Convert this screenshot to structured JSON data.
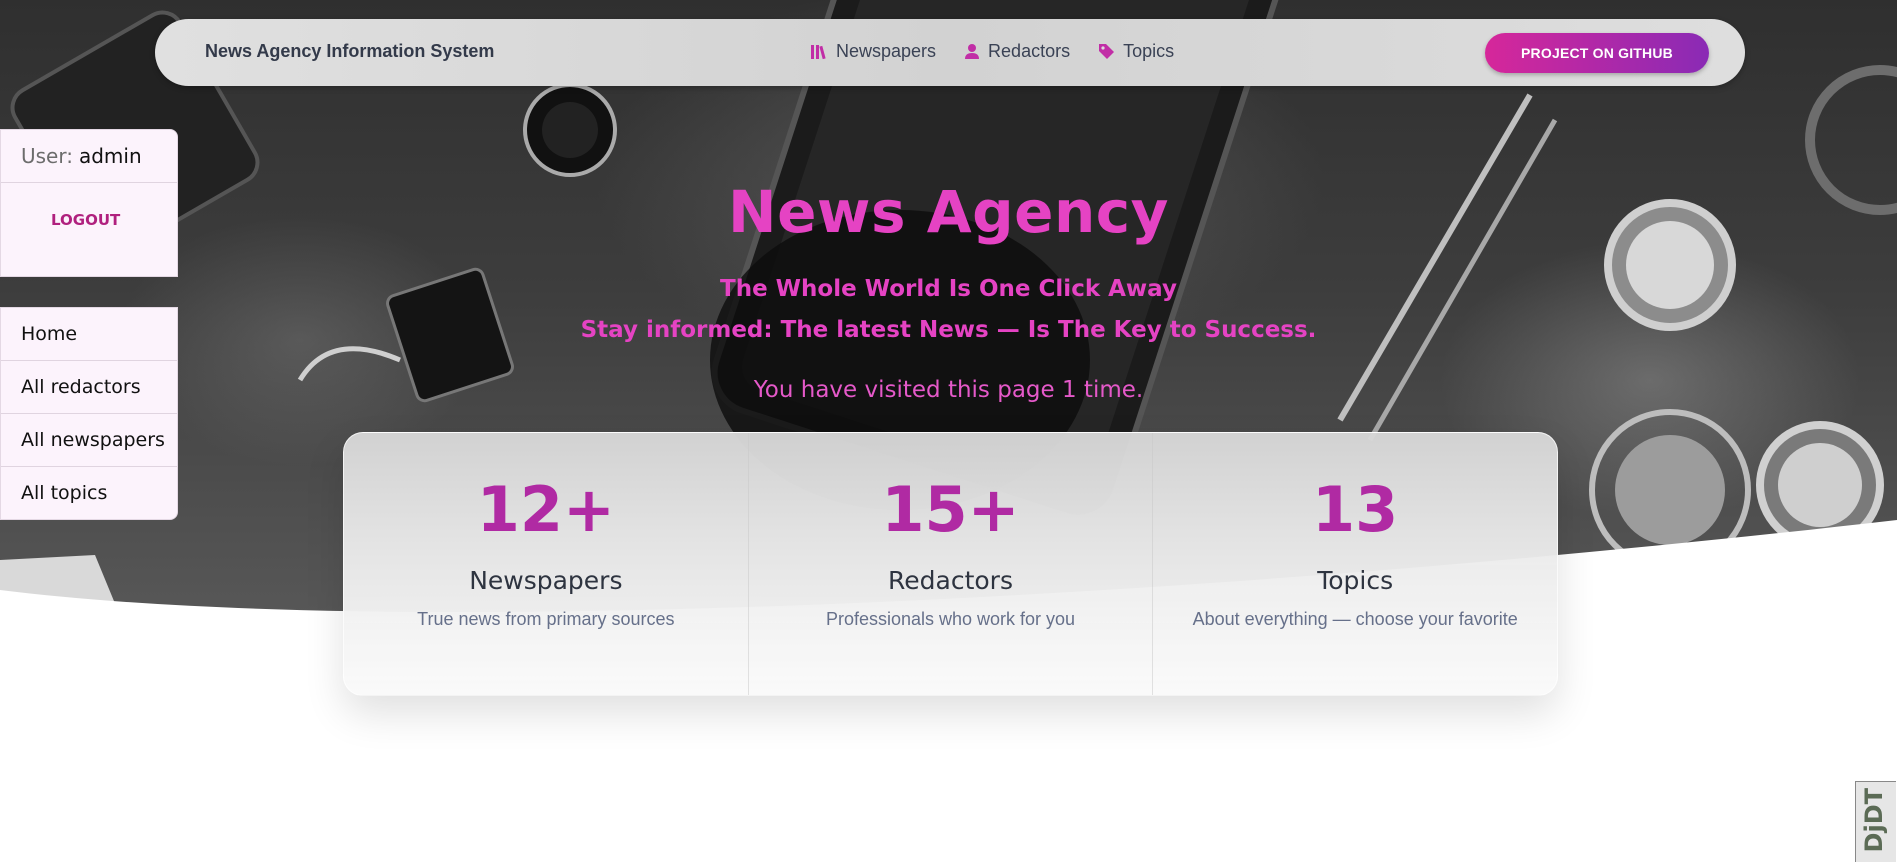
{
  "navbar": {
    "brand": "News Agency Information System",
    "links": [
      {
        "label": "Newspapers",
        "icon": "books-icon"
      },
      {
        "label": "Redactors",
        "icon": "user-icon"
      },
      {
        "label": "Topics",
        "icon": "tag-icon"
      }
    ],
    "github_button": "PROJECT ON GITHUB"
  },
  "user_panel": {
    "user_label": "User:",
    "username": "admin",
    "logout": "LOGOUT"
  },
  "sidebar": {
    "items": [
      {
        "label": "Home"
      },
      {
        "label": "All redactors"
      },
      {
        "label": "All newspapers"
      },
      {
        "label": "All topics"
      }
    ]
  },
  "hero": {
    "title": "News Agency",
    "subtitle_1": "The Whole World Is One Click Away",
    "subtitle_2": "Stay informed: The latest News — Is The Key to Success.",
    "visits": "You have visited this page 1 time."
  },
  "stats": [
    {
      "number": "12+",
      "title": "Newspapers",
      "desc": "True news from primary sources"
    },
    {
      "number": "15+",
      "title": "Redactors",
      "desc": "Professionals who work for you"
    },
    {
      "number": "13",
      "title": "Topics",
      "desc": "About everything — choose your favorite"
    }
  ],
  "debug_toolbar": {
    "label": "DjDT"
  },
  "colors": {
    "accent": "#e543c3",
    "stat_number": "#b02aa3",
    "button_gradient_start": "#d6279a",
    "button_gradient_end": "#8a2ab5"
  }
}
